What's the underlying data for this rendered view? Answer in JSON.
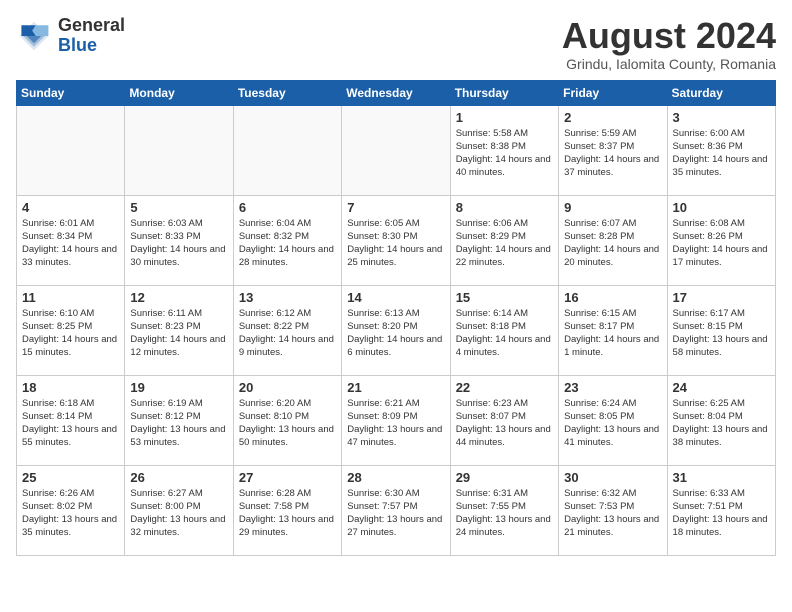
{
  "header": {
    "logo_general": "General",
    "logo_blue": "Blue",
    "month_year": "August 2024",
    "location": "Grindu, Ialomita County, Romania"
  },
  "days_of_week": [
    "Sunday",
    "Monday",
    "Tuesday",
    "Wednesday",
    "Thursday",
    "Friday",
    "Saturday"
  ],
  "weeks": [
    [
      {
        "day": "",
        "info": ""
      },
      {
        "day": "",
        "info": ""
      },
      {
        "day": "",
        "info": ""
      },
      {
        "day": "",
        "info": ""
      },
      {
        "day": "1",
        "info": "Sunrise: 5:58 AM\nSunset: 8:38 PM\nDaylight: 14 hours\nand 40 minutes."
      },
      {
        "day": "2",
        "info": "Sunrise: 5:59 AM\nSunset: 8:37 PM\nDaylight: 14 hours\nand 37 minutes."
      },
      {
        "day": "3",
        "info": "Sunrise: 6:00 AM\nSunset: 8:36 PM\nDaylight: 14 hours\nand 35 minutes."
      }
    ],
    [
      {
        "day": "4",
        "info": "Sunrise: 6:01 AM\nSunset: 8:34 PM\nDaylight: 14 hours\nand 33 minutes."
      },
      {
        "day": "5",
        "info": "Sunrise: 6:03 AM\nSunset: 8:33 PM\nDaylight: 14 hours\nand 30 minutes."
      },
      {
        "day": "6",
        "info": "Sunrise: 6:04 AM\nSunset: 8:32 PM\nDaylight: 14 hours\nand 28 minutes."
      },
      {
        "day": "7",
        "info": "Sunrise: 6:05 AM\nSunset: 8:30 PM\nDaylight: 14 hours\nand 25 minutes."
      },
      {
        "day": "8",
        "info": "Sunrise: 6:06 AM\nSunset: 8:29 PM\nDaylight: 14 hours\nand 22 minutes."
      },
      {
        "day": "9",
        "info": "Sunrise: 6:07 AM\nSunset: 8:28 PM\nDaylight: 14 hours\nand 20 minutes."
      },
      {
        "day": "10",
        "info": "Sunrise: 6:08 AM\nSunset: 8:26 PM\nDaylight: 14 hours\nand 17 minutes."
      }
    ],
    [
      {
        "day": "11",
        "info": "Sunrise: 6:10 AM\nSunset: 8:25 PM\nDaylight: 14 hours\nand 15 minutes."
      },
      {
        "day": "12",
        "info": "Sunrise: 6:11 AM\nSunset: 8:23 PM\nDaylight: 14 hours\nand 12 minutes."
      },
      {
        "day": "13",
        "info": "Sunrise: 6:12 AM\nSunset: 8:22 PM\nDaylight: 14 hours\nand 9 minutes."
      },
      {
        "day": "14",
        "info": "Sunrise: 6:13 AM\nSunset: 8:20 PM\nDaylight: 14 hours\nand 6 minutes."
      },
      {
        "day": "15",
        "info": "Sunrise: 6:14 AM\nSunset: 8:18 PM\nDaylight: 14 hours\nand 4 minutes."
      },
      {
        "day": "16",
        "info": "Sunrise: 6:15 AM\nSunset: 8:17 PM\nDaylight: 14 hours\nand 1 minute."
      },
      {
        "day": "17",
        "info": "Sunrise: 6:17 AM\nSunset: 8:15 PM\nDaylight: 13 hours\nand 58 minutes."
      }
    ],
    [
      {
        "day": "18",
        "info": "Sunrise: 6:18 AM\nSunset: 8:14 PM\nDaylight: 13 hours\nand 55 minutes."
      },
      {
        "day": "19",
        "info": "Sunrise: 6:19 AM\nSunset: 8:12 PM\nDaylight: 13 hours\nand 53 minutes."
      },
      {
        "day": "20",
        "info": "Sunrise: 6:20 AM\nSunset: 8:10 PM\nDaylight: 13 hours\nand 50 minutes."
      },
      {
        "day": "21",
        "info": "Sunrise: 6:21 AM\nSunset: 8:09 PM\nDaylight: 13 hours\nand 47 minutes."
      },
      {
        "day": "22",
        "info": "Sunrise: 6:23 AM\nSunset: 8:07 PM\nDaylight: 13 hours\nand 44 minutes."
      },
      {
        "day": "23",
        "info": "Sunrise: 6:24 AM\nSunset: 8:05 PM\nDaylight: 13 hours\nand 41 minutes."
      },
      {
        "day": "24",
        "info": "Sunrise: 6:25 AM\nSunset: 8:04 PM\nDaylight: 13 hours\nand 38 minutes."
      }
    ],
    [
      {
        "day": "25",
        "info": "Sunrise: 6:26 AM\nSunset: 8:02 PM\nDaylight: 13 hours\nand 35 minutes."
      },
      {
        "day": "26",
        "info": "Sunrise: 6:27 AM\nSunset: 8:00 PM\nDaylight: 13 hours\nand 32 minutes."
      },
      {
        "day": "27",
        "info": "Sunrise: 6:28 AM\nSunset: 7:58 PM\nDaylight: 13 hours\nand 29 minutes."
      },
      {
        "day": "28",
        "info": "Sunrise: 6:30 AM\nSunset: 7:57 PM\nDaylight: 13 hours\nand 27 minutes."
      },
      {
        "day": "29",
        "info": "Sunrise: 6:31 AM\nSunset: 7:55 PM\nDaylight: 13 hours\nand 24 minutes."
      },
      {
        "day": "30",
        "info": "Sunrise: 6:32 AM\nSunset: 7:53 PM\nDaylight: 13 hours\nand 21 minutes."
      },
      {
        "day": "31",
        "info": "Sunrise: 6:33 AM\nSunset: 7:51 PM\nDaylight: 13 hours\nand 18 minutes."
      }
    ]
  ]
}
